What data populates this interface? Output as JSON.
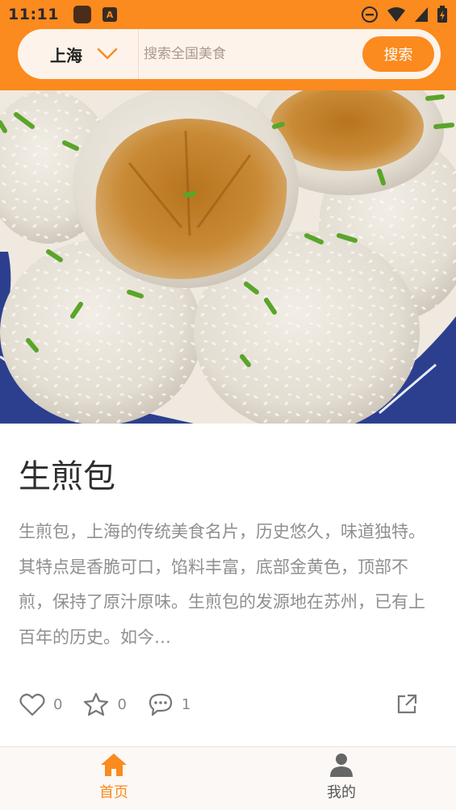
{
  "status_bar": {
    "time": "11:11",
    "icons": [
      "app-icon",
      "a-badge-icon",
      "do-not-disturb-icon",
      "wifi-icon",
      "signal-icon",
      "battery-icon"
    ]
  },
  "header": {
    "city": "上海",
    "search_placeholder": "搜索全国美食",
    "search_button": "搜索"
  },
  "article": {
    "title": "生煎包",
    "description": "生煎包，上海的传统美食名片，历史悠久，味道独特。其特点是香脆可口，馅料丰富，底部金黄色，顶部不煎，保持了原汁原味。生煎包的发源地在苏州，已有上百年的历史。如今…",
    "likes": "0",
    "favorites": "0",
    "comments": "1"
  },
  "bottom_nav": {
    "tabs": [
      {
        "label": "首页",
        "icon": "home-icon",
        "active": true
      },
      {
        "label": "我的",
        "icon": "user-icon",
        "active": false
      }
    ]
  },
  "colors": {
    "accent": "#fb8a1f",
    "header_bg": "#fb8a1f",
    "search_bg": "#fdf3ea",
    "text_muted": "#8f8f8f"
  }
}
